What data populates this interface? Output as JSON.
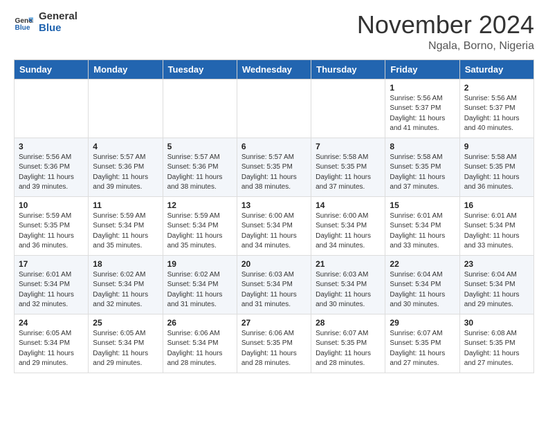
{
  "header": {
    "logo_general": "General",
    "logo_blue": "Blue",
    "month": "November 2024",
    "location": "Ngala, Borno, Nigeria"
  },
  "weekdays": [
    "Sunday",
    "Monday",
    "Tuesday",
    "Wednesday",
    "Thursday",
    "Friday",
    "Saturday"
  ],
  "weeks": [
    [
      {
        "day": "",
        "info": ""
      },
      {
        "day": "",
        "info": ""
      },
      {
        "day": "",
        "info": ""
      },
      {
        "day": "",
        "info": ""
      },
      {
        "day": "",
        "info": ""
      },
      {
        "day": "1",
        "info": "Sunrise: 5:56 AM\nSunset: 5:37 PM\nDaylight: 11 hours\nand 41 minutes."
      },
      {
        "day": "2",
        "info": "Sunrise: 5:56 AM\nSunset: 5:37 PM\nDaylight: 11 hours\nand 40 minutes."
      }
    ],
    [
      {
        "day": "3",
        "info": "Sunrise: 5:56 AM\nSunset: 5:36 PM\nDaylight: 11 hours\nand 39 minutes."
      },
      {
        "day": "4",
        "info": "Sunrise: 5:57 AM\nSunset: 5:36 PM\nDaylight: 11 hours\nand 39 minutes."
      },
      {
        "day": "5",
        "info": "Sunrise: 5:57 AM\nSunset: 5:36 PM\nDaylight: 11 hours\nand 38 minutes."
      },
      {
        "day": "6",
        "info": "Sunrise: 5:57 AM\nSunset: 5:35 PM\nDaylight: 11 hours\nand 38 minutes."
      },
      {
        "day": "7",
        "info": "Sunrise: 5:58 AM\nSunset: 5:35 PM\nDaylight: 11 hours\nand 37 minutes."
      },
      {
        "day": "8",
        "info": "Sunrise: 5:58 AM\nSunset: 5:35 PM\nDaylight: 11 hours\nand 37 minutes."
      },
      {
        "day": "9",
        "info": "Sunrise: 5:58 AM\nSunset: 5:35 PM\nDaylight: 11 hours\nand 36 minutes."
      }
    ],
    [
      {
        "day": "10",
        "info": "Sunrise: 5:59 AM\nSunset: 5:35 PM\nDaylight: 11 hours\nand 36 minutes."
      },
      {
        "day": "11",
        "info": "Sunrise: 5:59 AM\nSunset: 5:34 PM\nDaylight: 11 hours\nand 35 minutes."
      },
      {
        "day": "12",
        "info": "Sunrise: 5:59 AM\nSunset: 5:34 PM\nDaylight: 11 hours\nand 35 minutes."
      },
      {
        "day": "13",
        "info": "Sunrise: 6:00 AM\nSunset: 5:34 PM\nDaylight: 11 hours\nand 34 minutes."
      },
      {
        "day": "14",
        "info": "Sunrise: 6:00 AM\nSunset: 5:34 PM\nDaylight: 11 hours\nand 34 minutes."
      },
      {
        "day": "15",
        "info": "Sunrise: 6:01 AM\nSunset: 5:34 PM\nDaylight: 11 hours\nand 33 minutes."
      },
      {
        "day": "16",
        "info": "Sunrise: 6:01 AM\nSunset: 5:34 PM\nDaylight: 11 hours\nand 33 minutes."
      }
    ],
    [
      {
        "day": "17",
        "info": "Sunrise: 6:01 AM\nSunset: 5:34 PM\nDaylight: 11 hours\nand 32 minutes."
      },
      {
        "day": "18",
        "info": "Sunrise: 6:02 AM\nSunset: 5:34 PM\nDaylight: 11 hours\nand 32 minutes."
      },
      {
        "day": "19",
        "info": "Sunrise: 6:02 AM\nSunset: 5:34 PM\nDaylight: 11 hours\nand 31 minutes."
      },
      {
        "day": "20",
        "info": "Sunrise: 6:03 AM\nSunset: 5:34 PM\nDaylight: 11 hours\nand 31 minutes."
      },
      {
        "day": "21",
        "info": "Sunrise: 6:03 AM\nSunset: 5:34 PM\nDaylight: 11 hours\nand 30 minutes."
      },
      {
        "day": "22",
        "info": "Sunrise: 6:04 AM\nSunset: 5:34 PM\nDaylight: 11 hours\nand 30 minutes."
      },
      {
        "day": "23",
        "info": "Sunrise: 6:04 AM\nSunset: 5:34 PM\nDaylight: 11 hours\nand 29 minutes."
      }
    ],
    [
      {
        "day": "24",
        "info": "Sunrise: 6:05 AM\nSunset: 5:34 PM\nDaylight: 11 hours\nand 29 minutes."
      },
      {
        "day": "25",
        "info": "Sunrise: 6:05 AM\nSunset: 5:34 PM\nDaylight: 11 hours\nand 29 minutes."
      },
      {
        "day": "26",
        "info": "Sunrise: 6:06 AM\nSunset: 5:34 PM\nDaylight: 11 hours\nand 28 minutes."
      },
      {
        "day": "27",
        "info": "Sunrise: 6:06 AM\nSunset: 5:35 PM\nDaylight: 11 hours\nand 28 minutes."
      },
      {
        "day": "28",
        "info": "Sunrise: 6:07 AM\nSunset: 5:35 PM\nDaylight: 11 hours\nand 28 minutes."
      },
      {
        "day": "29",
        "info": "Sunrise: 6:07 AM\nSunset: 5:35 PM\nDaylight: 11 hours\nand 27 minutes."
      },
      {
        "day": "30",
        "info": "Sunrise: 6:08 AM\nSunset: 5:35 PM\nDaylight: 11 hours\nand 27 minutes."
      }
    ]
  ]
}
